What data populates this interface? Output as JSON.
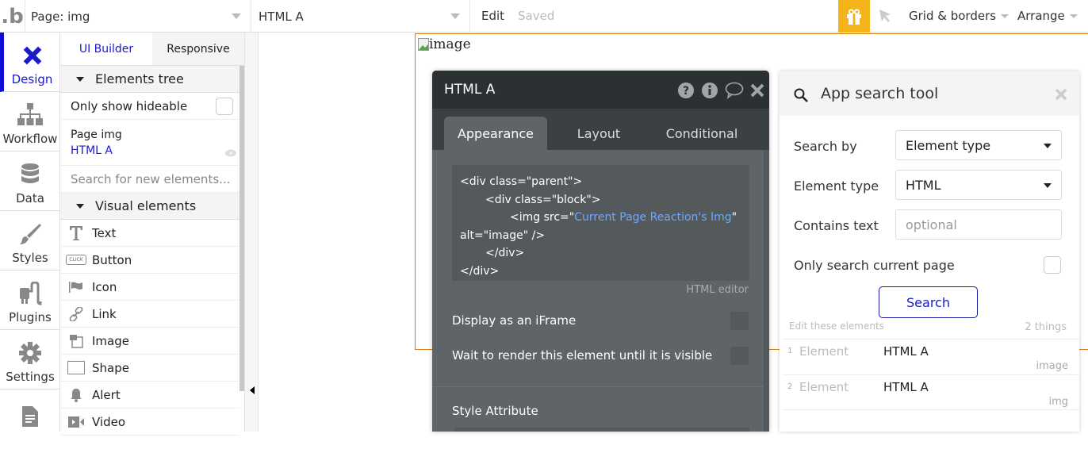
{
  "topbar": {
    "logo": ".b",
    "page_selector": "Page: img",
    "element_selector": "HTML A",
    "edit_label": "Edit",
    "saved_label": "Saved",
    "gift_icon": "gift-icon",
    "cursor_icon": "cursor-icon",
    "grid_borders_label": "Grid & borders",
    "arrange_label": "Arrange",
    "accent_color": "#f5b31a"
  },
  "leftnav": {
    "active_color": "#1a1acb",
    "items": [
      {
        "label": "Design",
        "icon": "design-icon",
        "active": true
      },
      {
        "label": "Workflow",
        "icon": "workflow-icon",
        "active": false
      },
      {
        "label": "Data",
        "icon": "database-icon",
        "active": false
      },
      {
        "label": "Styles",
        "icon": "brush-icon",
        "active": false
      },
      {
        "label": "Plugins",
        "icon": "plug-icon",
        "active": false
      },
      {
        "label": "Settings",
        "icon": "gear-icon",
        "active": false
      },
      {
        "label": "",
        "icon": "document-icon",
        "active": false
      }
    ]
  },
  "elements_panel": {
    "tabs": [
      "UI Builder",
      "Responsive"
    ],
    "elements_tree_header": "Elements tree",
    "only_show_hideable": "Only show hideable",
    "tree": {
      "page": "Page img",
      "selected": "HTML A"
    },
    "search_placeholder": "Search for new elements...",
    "visual_elements_header": "Visual elements",
    "visual_elements": [
      {
        "label": "Text",
        "icon": "text-icon"
      },
      {
        "label": "Button",
        "icon": "button-icon",
        "icon_text": "CLICK"
      },
      {
        "label": "Icon",
        "icon": "flag-icon"
      },
      {
        "label": "Link",
        "icon": "link-icon"
      },
      {
        "label": "Image",
        "icon": "image-icon"
      },
      {
        "label": "Shape",
        "icon": "shape-icon"
      },
      {
        "label": "Alert",
        "icon": "bell-icon"
      },
      {
        "label": "Video",
        "icon": "video-icon"
      }
    ]
  },
  "canvas": {
    "broken_image_alt": "image",
    "selection_color": "#d97b14"
  },
  "property_editor": {
    "title": "HTML A",
    "tabs": [
      "Appearance",
      "Layout",
      "Conditional"
    ],
    "active_tab": "Appearance",
    "code": {
      "line1": "<div class=\"parent\">",
      "line2": "<div class=\"block\">",
      "line3_prefix": "<img src=\"",
      "line3_dynamic": "Current Page Reaction's Img",
      "line3_suffix": "\"",
      "line4": "alt=\"image\" />",
      "line5": "</div>",
      "line6": "</div>"
    },
    "html_editor_label": "HTML editor",
    "display_iframe_label": "Display as an iFrame",
    "wait_render_label": "Wait to render this element until it is visible",
    "style_attribute_label": "Style Attribute"
  },
  "search_tool": {
    "title": "App search tool",
    "search_by_label": "Search by",
    "search_by_value": "Element type",
    "element_type_label": "Element type",
    "element_type_value": "HTML",
    "contains_text_label": "Contains text",
    "contains_text_placeholder": "optional",
    "only_current_page_label": "Only search current page",
    "search_button": "Search",
    "edit_these_label": "Edit these elements",
    "count_label": "2 things",
    "results": [
      {
        "num": "1",
        "type": "Element",
        "name": "HTML A",
        "match": "image"
      },
      {
        "num": "2",
        "type": "Element",
        "name": "HTML A",
        "match": "img"
      }
    ]
  }
}
